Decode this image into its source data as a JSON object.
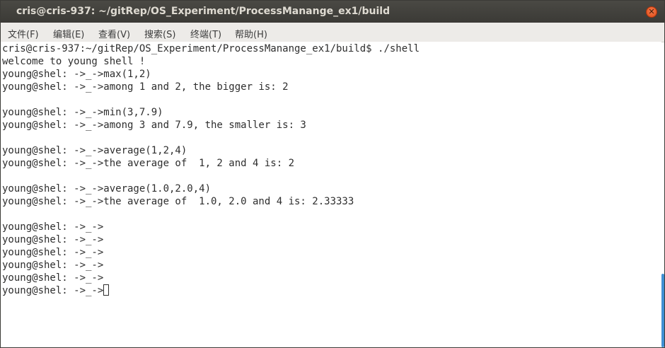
{
  "window": {
    "title": "cris@cris-937: ~/gitRep/OS_Experiment/ProcessManange_ex1/build",
    "close_glyph": "✕"
  },
  "menubar": {
    "items": [
      "文件(F)",
      "编辑(E)",
      "查看(V)",
      "搜索(S)",
      "终端(T)",
      "帮助(H)"
    ]
  },
  "terminal": {
    "lines": [
      "cris@cris-937:~/gitRep/OS_Experiment/ProcessManange_ex1/build$ ./shell",
      "welcome to young shell !",
      "young@shel: ->_->max(1,2)",
      "young@shel: ->_->among 1 and 2, the bigger is: 2",
      "",
      "young@shel: ->_->min(3,7.9)",
      "young@shel: ->_->among 3 and 7.9, the smaller is: 3",
      "",
      "young@shel: ->_->average(1,2,4)",
      "young@shel: ->_->the average of  1, 2 and 4 is: 2",
      "",
      "young@shel: ->_->average(1.0,2.0,4)",
      "young@shel: ->_->the average of  1.0, 2.0 and 4 is: 2.33333",
      "",
      "young@shel: ->_->",
      "young@shel: ->_->",
      "young@shel: ->_->",
      "young@shel: ->_->",
      "young@shel: ->_->"
    ],
    "prompt": "young@shel: ->_->"
  },
  "colors": {
    "titlebar_bg": "#3c3b37",
    "title_text": "#dfdbd2",
    "close_button": "#df4a16",
    "menubar_bg": "#edebe8",
    "terminal_bg": "#ffffff",
    "terminal_text": "#2e2e2e",
    "scrollbar_thumb": "#3f8fd2"
  }
}
